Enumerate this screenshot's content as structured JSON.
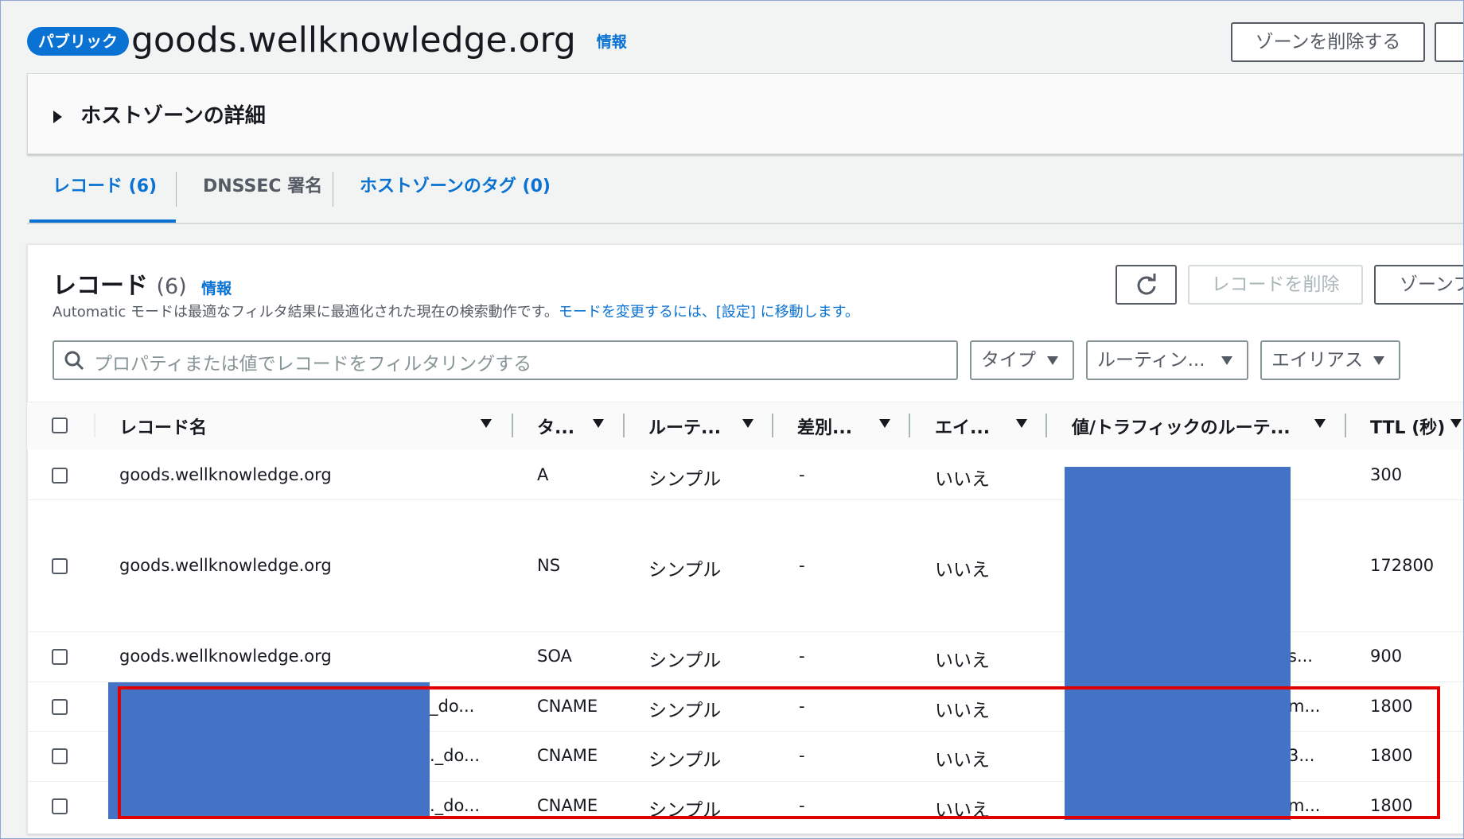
{
  "header": {
    "badge": "パブリック",
    "title": "goods.wellknowledge.org",
    "info": "情報",
    "delete_zone_button": "ゾーンを削除する"
  },
  "details_panel": {
    "label": "ホストゾーンの詳細"
  },
  "tabs": [
    {
      "label": "レコード (6)"
    },
    {
      "label": "DNSSEC 署名"
    },
    {
      "label": "ホストゾーンのタグ (0)"
    }
  ],
  "records_panel": {
    "title": "レコード",
    "count": "(6)",
    "info": "情報",
    "description": "Automatic モードは最適なフィルタ結果に最適化された現在の検索動作です。",
    "description_link": "モードを変更するには、[設定] に移動します。",
    "delete_records_button": "レコードを削除",
    "import_zone_button": "ゾーンフ",
    "search_placeholder": "プロパティまたは値でレコードをフィルタリングする",
    "filters": [
      "タイプ",
      "ルーティン...",
      "エイリアス"
    ]
  },
  "table": {
    "columns": [
      "レコード名",
      "タ...",
      "ルーテ...",
      "差別...",
      "エイ...",
      "値/トラフィックのルーテ...",
      "TTL (秒)"
    ],
    "rows": [
      {
        "name": "goods.wellknowledge.org",
        "type": "A",
        "routing": "シンプル",
        "diff": "-",
        "alias": "いいえ",
        "value": "",
        "ttl": "300"
      },
      {
        "name": "goods.wellknowledge.org",
        "type": "NS",
        "routing": "シンプル",
        "diff": "-",
        "alias": "いいえ",
        "value": "",
        "ttl": "172800"
      },
      {
        "name": "goods.wellknowledge.org",
        "type": "SOA",
        "routing": "シンプル",
        "diff": "-",
        "alias": "いいえ",
        "value": "s...",
        "ttl": "900"
      },
      {
        "name": "_do...",
        "type": "CNAME",
        "routing": "シンプル",
        "diff": "-",
        "alias": "いいえ",
        "value": "m...",
        "ttl": "1800"
      },
      {
        "name": "._do...",
        "type": "CNAME",
        "routing": "シンプル",
        "diff": "-",
        "alias": "いいえ",
        "value": "3...",
        "ttl": "1800"
      },
      {
        "name": "._do...",
        "type": "CNAME",
        "routing": "シンプル",
        "diff": "-",
        "alias": "いいえ",
        "value": "m...",
        "ttl": "1800"
      }
    ]
  },
  "colors": {
    "accent": "#0972d3",
    "redaction": "#4472c4",
    "highlight_border": "#e00000"
  }
}
